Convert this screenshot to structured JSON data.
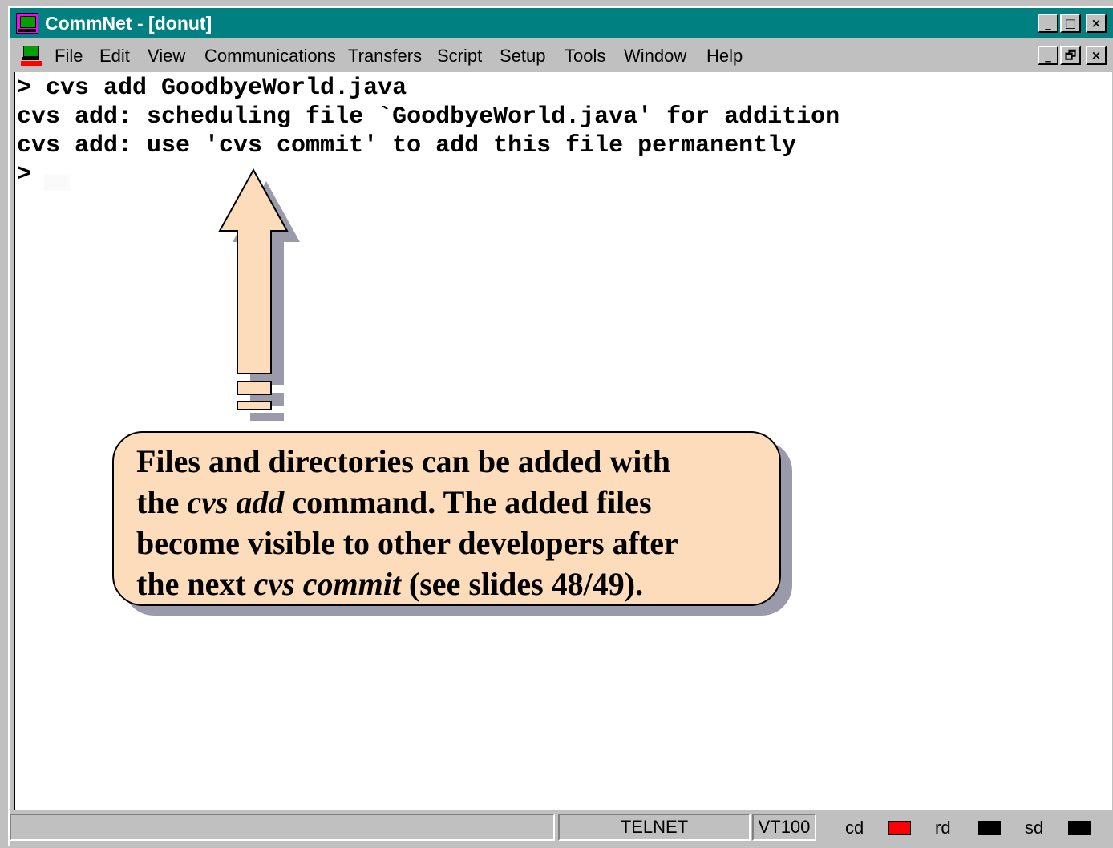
{
  "window": {
    "title": "CommNet - [donut]",
    "caption_buttons": [
      "_",
      "□",
      "×"
    ],
    "mdi_buttons": [
      "_",
      "🗗",
      "×"
    ]
  },
  "icons": {
    "app": "terminal-computer-icon",
    "document": "telnet-document-icon"
  },
  "menu": {
    "items": [
      "File",
      "Edit",
      "View",
      "Communications",
      "Transfers",
      "Script",
      "Setup",
      "Tools",
      "Window",
      "Help"
    ]
  },
  "terminal": {
    "lines": [
      "> cvs add GoodbyeWorld.java",
      "cvs add: scheduling file `GoodbyeWorld.java' for addition",
      "cvs add: use 'cvs commit' to add this file permanently",
      ">"
    ]
  },
  "callout": {
    "line1": "Files and directories can be added with",
    "line2_a": "the ",
    "line2_b": "cvs add",
    "line2_c": " command. The added files",
    "line3": "become visible to other developers after",
    "line4_a": "the next ",
    "line4_b": "cvs commit",
    "line4_c": " (see slides 48/49)."
  },
  "statusbar": {
    "protocol": "TELNET",
    "emulation": "VT100",
    "indicators": [
      {
        "label": "cd",
        "color": "#ff0000"
      },
      {
        "label": "rd",
        "color": "#000000"
      },
      {
        "label": "sd",
        "color": "#000000"
      }
    ]
  },
  "colors": {
    "titlebar": "#008080",
    "callout_fill": "#fddcbc",
    "arrow_fill": "#fddcbc"
  }
}
